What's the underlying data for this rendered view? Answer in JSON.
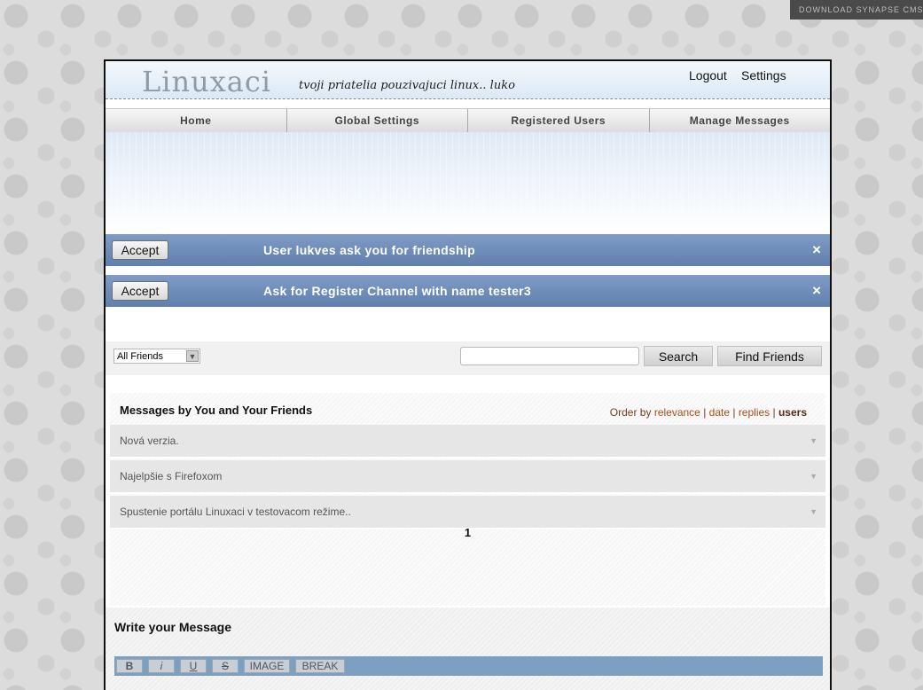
{
  "download_bar": {
    "label": "DOWNLOAD SYNAPSE CMS"
  },
  "header": {
    "logo": "Linuxaci",
    "tagline": "tvoji priatelia pouzivajuci linux.. luko",
    "logout": "Logout",
    "settings": "Settings"
  },
  "nav": {
    "items": [
      {
        "label": "Home"
      },
      {
        "label": "Global Settings"
      },
      {
        "label": "Registered Users"
      },
      {
        "label": "Manage Messages"
      }
    ]
  },
  "notices": [
    {
      "accept_label": "Accept",
      "text": "User lukves ask you for friendship",
      "close": "×"
    },
    {
      "accept_label": "Accept",
      "text": "Ask for Register Channel with name tester3",
      "close": "×"
    }
  ],
  "filter": {
    "select_value": "All Friends",
    "search_value": "",
    "search_button": "Search",
    "find_friends_button": "Find Friends"
  },
  "messages": {
    "title": "Messages by You and Your Friends",
    "order_by_label": "Order by",
    "order_options": [
      "relevance",
      "date",
      "replies",
      "users"
    ],
    "active_order": "users",
    "rows": [
      {
        "title": "Nová verzia."
      },
      {
        "title": "Najelpšie s Firefoxom"
      },
      {
        "title": "Spustenie portálu Linuxaci v testovacom režime.."
      }
    ],
    "current_page": "1"
  },
  "compose": {
    "title": "Write your Message",
    "toolbar": [
      "B",
      "i",
      "U",
      "S",
      "IMAGE",
      "BREAK"
    ]
  },
  "colors": {
    "notice_bg": "#6a89b7",
    "toolbar_bg": "#7d9fc0",
    "order_link": "#b24a16"
  }
}
